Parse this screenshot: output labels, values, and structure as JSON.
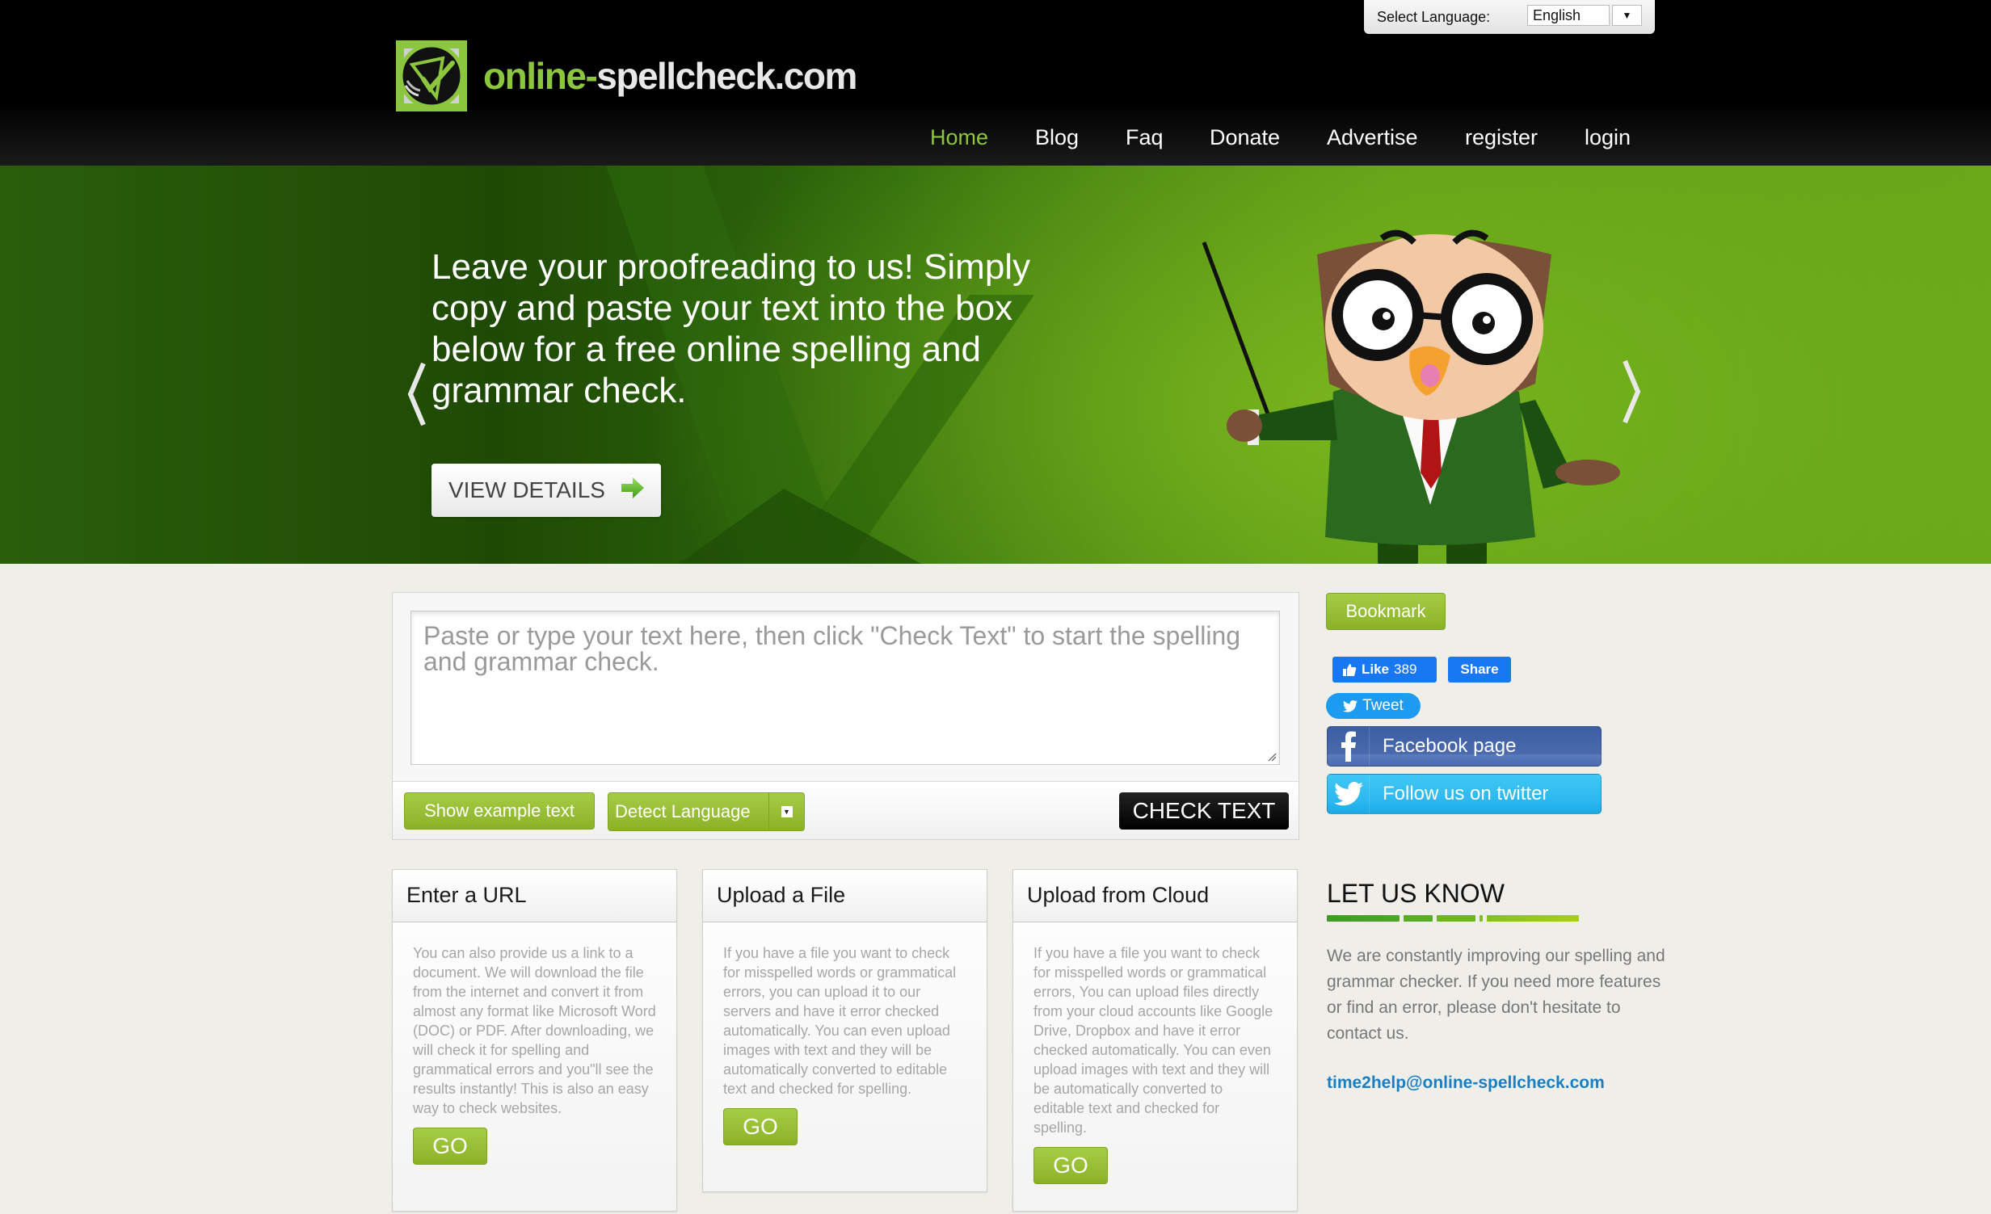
{
  "header": {
    "logo": {
      "part1": "online-",
      "part2": "spellcheck.com",
      "icon": "checkmark-document-logo-icon"
    },
    "language_selector": {
      "label": "Select Language:",
      "selected": "English",
      "icon": "triangle-down-icon"
    },
    "nav": [
      {
        "label": "Home",
        "active": true
      },
      {
        "label": "Blog",
        "active": false
      },
      {
        "label": "Faq",
        "active": false
      },
      {
        "label": "Donate",
        "active": false
      },
      {
        "label": "Advertise",
        "active": false
      },
      {
        "label": "register",
        "active": false
      },
      {
        "label": "login",
        "active": false
      }
    ]
  },
  "hero": {
    "text": "Leave your proofreading to us!  Simply copy and paste your text into the box below for a free online spelling and grammar check.",
    "button_label": "VIEW DETAILS",
    "button_icon": "arrow-right-icon",
    "prev_icon": "chevron-left-icon",
    "next_icon": "chevron-right-icon",
    "illustration": "owl-teacher-mascot"
  },
  "checker": {
    "textarea_placeholder": "Paste or type your text here, then click \"Check Text\" to start the spelling and grammar check.",
    "textarea_value": "",
    "show_example_label": "Show example text",
    "language_select": "Detect Language",
    "check_label": "CHECK TEXT"
  },
  "options": [
    {
      "title": "Enter a URL",
      "body": "You can also provide us a link to a document. We will download the file from the internet and convert it from almost any format like Microsoft Word (DOC) or PDF. After downloading, we will check it for spelling and grammatical errors and you\"ll see the results instantly! This is also an easy way to check websites.",
      "button": "GO"
    },
    {
      "title": "Upload a File",
      "body": "If you have a file you want to check for misspelled words or grammatical errors, you can upload it to our servers and have it error checked automatically. You can even upload images with text and they will be automatically converted to editable text and checked for spelling.",
      "button": "GO"
    },
    {
      "title": "Upload from Cloud",
      "body": "If you have a file you want to check for misspelled words or grammatical errors, You can upload files directly from your cloud accounts like Google Drive, Dropbox and have it error checked automatically. You can even upload images with text and they will be automatically converted to editable text and checked for spelling.",
      "button": "GO"
    }
  ],
  "sidebar": {
    "bookmark_label": "Bookmark",
    "fb_like_label": "Like",
    "fb_like_count": "389",
    "fb_share_label": "Share",
    "tweet_label": "Tweet",
    "facebook_page_label": "Facebook page",
    "twitter_follow_label": "Follow us on twitter",
    "let_us_know": {
      "title": "LET US KNOW",
      "body": "We are constantly improving our spelling and grammar checker. If you need more features or find an error, please don't hesitate to contact us.",
      "email": "time2help@online-spellcheck.com"
    }
  },
  "colors": {
    "brand_green": "#8cc63f",
    "button_green": "#97be33",
    "header_bg": "#000000",
    "facebook_blue": "#1877f2",
    "facebook_page": "#4a6aad",
    "twitter_blue": "#2bb7ef",
    "link_blue": "#1a7fc0"
  }
}
